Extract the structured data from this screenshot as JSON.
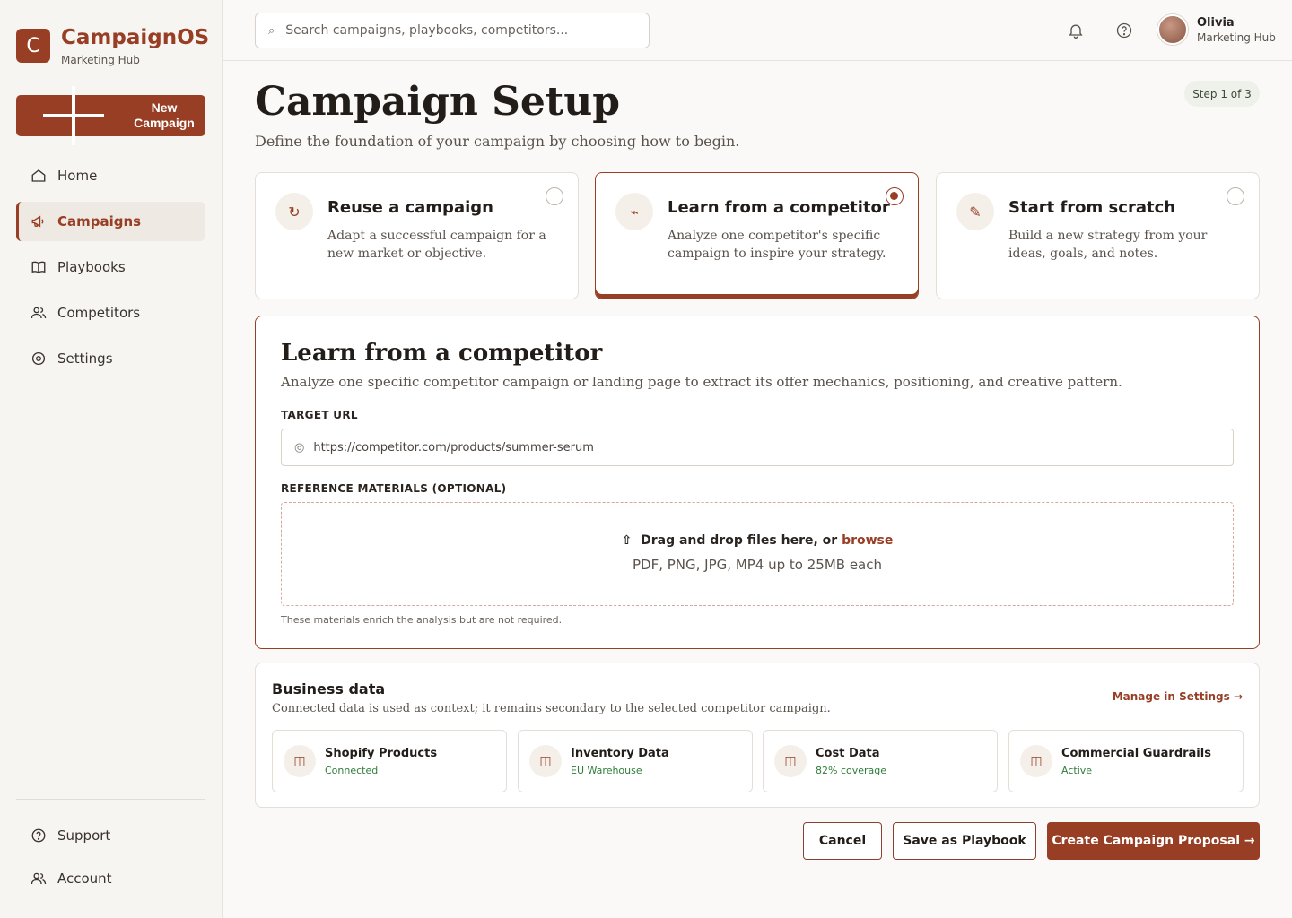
{
  "brand": {
    "logo_letter": "C",
    "name": "CampaignOS",
    "subtitle": "Marketing Hub"
  },
  "sidebar": {
    "new_campaign_label": "New Campaign",
    "items": [
      {
        "label": "Home",
        "icon": "home-icon"
      },
      {
        "label": "Campaigns",
        "icon": "megaphone-icon",
        "active": true
      },
      {
        "label": "Playbooks",
        "icon": "book-icon"
      },
      {
        "label": "Competitors",
        "icon": "users-icon"
      },
      {
        "label": "Settings",
        "icon": "gear-icon"
      }
    ],
    "bottom_items": [
      {
        "label": "Support",
        "icon": "help-circle-icon"
      },
      {
        "label": "Account",
        "icon": "user-icon"
      }
    ]
  },
  "header": {
    "search_placeholder": "Search campaigns, playbooks, competitors...",
    "user": {
      "name": "Olivia",
      "role": "Marketing Hub"
    }
  },
  "page": {
    "title": "Campaign Setup",
    "subtitle": "Define the foundation of your campaign by choosing how to begin.",
    "step": "Step 1 of 3"
  },
  "options": [
    {
      "title": "Reuse a campaign",
      "desc": "Adapt a successful campaign for a new market or objective.",
      "icon": "↻",
      "selected": false
    },
    {
      "title": "Learn from a competitor",
      "desc": "Analyze one competitor's specific campaign to inspire your strategy.",
      "icon": "⌁",
      "selected": true
    },
    {
      "title": "Start from scratch",
      "desc": "Build a new strategy from your ideas, goals, and notes.",
      "icon": "✎",
      "selected": false
    }
  ],
  "competitor_panel": {
    "title": "Learn from a competitor",
    "desc": "Analyze one specific competitor campaign or landing page to extract its offer mechanics, positioning, and creative pattern.",
    "url_label": "TARGET URL",
    "url_value": "https://competitor.com/products/summer-serum",
    "ref_label": "REFERENCE MATERIALS (OPTIONAL)",
    "drop_text": "Drag and drop files here, or",
    "drop_link": "browse",
    "drop_sub": "PDF, PNG, JPG, MP4 up to 25MB each",
    "hint": "These materials enrich the analysis but are not required."
  },
  "business": {
    "title": "Business data",
    "desc": "Connected data is used as context; it remains secondary to the selected competitor campaign.",
    "manage_label": "Manage in Settings →",
    "sources": [
      {
        "name": "Shopify Products",
        "status": "Connected"
      },
      {
        "name": "Inventory Data",
        "status": "EU Warehouse"
      },
      {
        "name": "Cost Data",
        "status": "82% coverage"
      },
      {
        "name": "Commercial Guardrails",
        "status": "Active"
      }
    ]
  },
  "actions": {
    "cancel": "Cancel",
    "save_playbook": "Save as Playbook",
    "create": "Create Campaign Proposal →"
  },
  "colors": {
    "accent": "#983e24",
    "success": "#2f7d3a"
  }
}
